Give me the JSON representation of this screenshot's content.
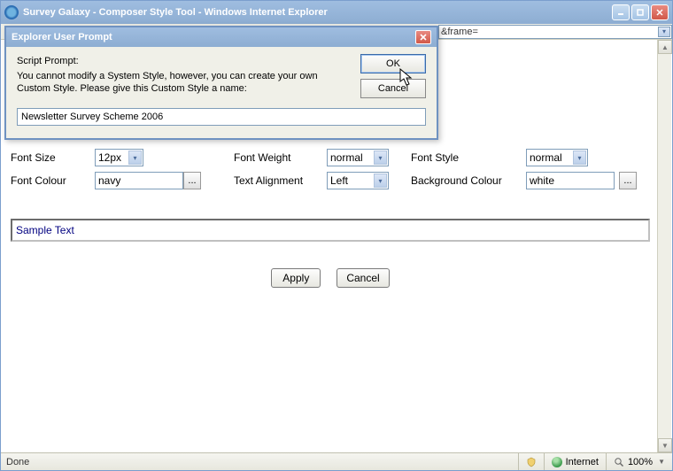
{
  "window": {
    "title": "Survey Galaxy - Composer Style Tool - Windows Internet Explorer"
  },
  "address": {
    "fragment": "&frame="
  },
  "dialog": {
    "title": "Explorer User Prompt",
    "prompt_label": "Script Prompt:",
    "message": "You cannot modify a System Style, however, you can create your own Custom Style. Please give this Custom Style a name:",
    "input_value": "Newsletter Survey Scheme 2006",
    "ok_label": "OK",
    "cancel_label": "Cancel"
  },
  "form": {
    "font_size_label": "Font Size",
    "font_size_value": "12px",
    "font_weight_label": "Font Weight",
    "font_weight_value": "normal",
    "font_style_label": "Font Style",
    "font_style_value": "normal",
    "font_colour_label": "Font Colour",
    "font_colour_value": "navy",
    "text_align_label": "Text Alignment",
    "text_align_value": "Left",
    "bg_colour_label": "Background Colour",
    "bg_colour_value": "white",
    "sample_text": "Sample Text",
    "apply_label": "Apply",
    "cancel_label": "Cancel"
  },
  "status": {
    "left": "Done",
    "zone": "Internet",
    "zoom": "100%"
  }
}
